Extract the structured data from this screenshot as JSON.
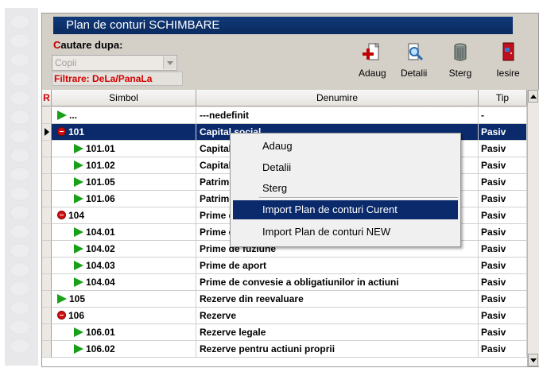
{
  "window": {
    "title": "Plan de conturi SCHIMBARE"
  },
  "search": {
    "label_first": "C",
    "label_rest": "autare dupa:",
    "value": "Copii",
    "filter": "Filtrare: DeLa/PanaLa"
  },
  "toolbar": {
    "add": "Adaug",
    "details": "Detalii",
    "delete": "Sterg",
    "exit": "Iesire"
  },
  "grid": {
    "marker": "R",
    "headers": [
      "Simbol",
      "Denumire",
      "Tip"
    ],
    "rows": [
      {
        "icon": "arrow",
        "indent": 0,
        "symbol": "...",
        "name": "---nedefinit",
        "type": "-"
      },
      {
        "icon": "stop",
        "indent": 0,
        "symbol": "101",
        "name": "Capital social",
        "type": "Pasiv",
        "selected": true
      },
      {
        "icon": "arrow",
        "indent": 1,
        "symbol": "101.01",
        "name": "Capital subscris nevarsat",
        "type": "Pasiv"
      },
      {
        "icon": "arrow",
        "indent": 1,
        "symbol": "101.02",
        "name": "Capital subscris varsat",
        "type": "Pasiv"
      },
      {
        "icon": "arrow",
        "indent": 1,
        "symbol": "101.05",
        "name": "Patrimoniul regiei",
        "type": "Pasiv"
      },
      {
        "icon": "arrow",
        "indent": 1,
        "symbol": "101.06",
        "name": "Patrimoniul public",
        "type": "Pasiv"
      },
      {
        "icon": "stop",
        "indent": 0,
        "symbol": "104",
        "name": "Prime de capital",
        "type": "Pasiv"
      },
      {
        "icon": "arrow",
        "indent": 1,
        "symbol": "104.01",
        "name": "Prime de emisiune",
        "type": "Pasiv"
      },
      {
        "icon": "arrow",
        "indent": 1,
        "symbol": "104.02",
        "name": "Prime de fuziune",
        "type": "Pasiv"
      },
      {
        "icon": "arrow",
        "indent": 1,
        "symbol": "104.03",
        "name": "Prime de aport",
        "type": "Pasiv"
      },
      {
        "icon": "arrow",
        "indent": 1,
        "symbol": "104.04",
        "name": "Prime de convesie a obligatiunilor in actiuni",
        "type": "Pasiv"
      },
      {
        "icon": "arrow",
        "indent": 0,
        "symbol": "105",
        "name": "Rezerve din reevaluare",
        "type": "Pasiv"
      },
      {
        "icon": "stop",
        "indent": 0,
        "symbol": "106",
        "name": "Rezerve",
        "type": "Pasiv"
      },
      {
        "icon": "arrow",
        "indent": 1,
        "symbol": "106.01",
        "name": "Rezerve legale",
        "type": "Pasiv"
      },
      {
        "icon": "arrow",
        "indent": 1,
        "symbol": "106.02",
        "name": "Rezerve pentru actiuni proprii",
        "type": "Pasiv"
      }
    ]
  },
  "context_menu": {
    "items": [
      "Adaug",
      "Detalii",
      "Sterg",
      "Import Plan de conturi Curent",
      "Import Plan de conturi NEW"
    ],
    "highlighted": "Import Plan de conturi Curent"
  },
  "colors": {
    "title_bar": "#0b2a6b",
    "selection": "#0b2a6b",
    "accent_red": "#d40000",
    "arrow_green": "#18a018"
  }
}
